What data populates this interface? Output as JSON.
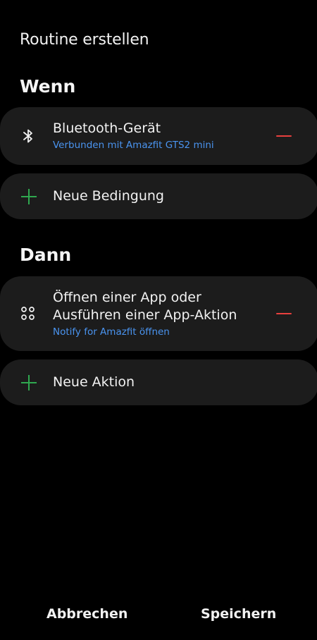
{
  "header": {
    "title": "Routine erstellen"
  },
  "when": {
    "title": "Wenn",
    "condition": {
      "icon": "bluetooth-icon",
      "title": "Bluetooth-Gerät",
      "subtitle": "Verbunden mit Amazfit GTS2 mini"
    },
    "add_label": "Neue Bedingung"
  },
  "then": {
    "title": "Dann",
    "action": {
      "icon": "apps-icon",
      "title_line1": "Öffnen einer App oder",
      "title_line2": "Ausführen einer App-Aktion",
      "subtitle": "Notify for Amazfit öffnen"
    },
    "add_label": "Neue Aktion"
  },
  "footer": {
    "cancel_label": "Abbrechen",
    "save_label": "Speichern"
  },
  "colors": {
    "background": "#000000",
    "card": "#1c1c1c",
    "link": "#4a94f0",
    "remove": "#e8403e",
    "add": "#2fa84f"
  }
}
